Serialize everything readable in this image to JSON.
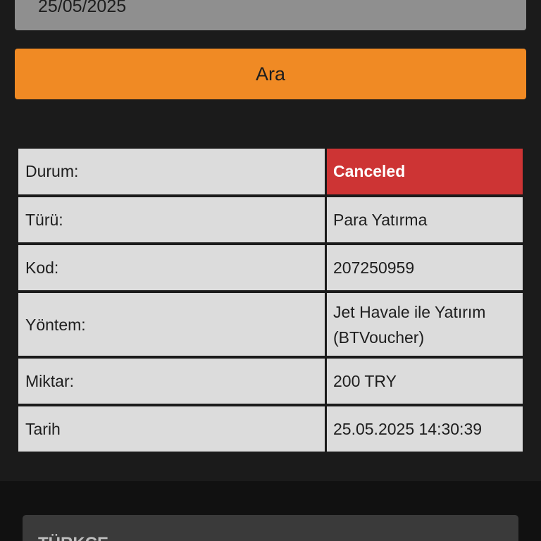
{
  "date_field": {
    "value": "25/05/2025"
  },
  "search_button": {
    "label": "Ara"
  },
  "details": {
    "status": {
      "label": "Durum:",
      "value": "Canceled",
      "color": "#cd3434"
    },
    "type": {
      "label": "Türü:",
      "value": "Para Yatırma"
    },
    "code": {
      "label": "Kod:",
      "value": "207250959"
    },
    "method": {
      "label": "Yöntem:",
      "value": "Jet Havale ile Yatırım (BTVoucher)"
    },
    "amount": {
      "label": "Miktar:",
      "value": "200 TRY"
    },
    "date": {
      "label": "Tarih",
      "value": "25.05.2025 14:30:39"
    }
  },
  "language_selector": {
    "label": "TÜRKÇE"
  },
  "colors": {
    "background": "#1b1b1b",
    "accent": "#f08a24",
    "status_canceled": "#cd3434",
    "cell_background": "#dcdcdc"
  }
}
